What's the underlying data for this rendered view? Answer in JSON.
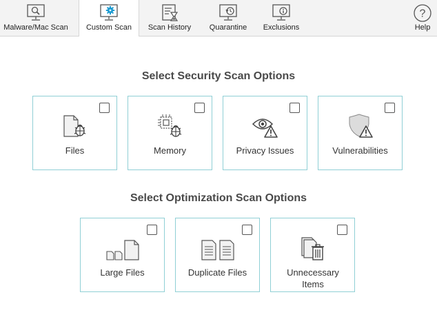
{
  "toolbar": {
    "tabs": [
      {
        "label": "Malware/Mac Scan",
        "icon": "monitor-magnifier-icon"
      },
      {
        "label": "Custom Scan",
        "icon": "monitor-gear-icon"
      },
      {
        "label": "Scan History",
        "icon": "history-hourglass-icon"
      },
      {
        "label": "Quarantine",
        "icon": "monitor-restore-icon"
      },
      {
        "label": "Exclusions",
        "icon": "monitor-info-icon"
      }
    ],
    "help": {
      "label": "Help",
      "icon": "help-icon"
    },
    "active_tab": "Custom Scan"
  },
  "security": {
    "title": "Select Security Scan Options",
    "options": [
      {
        "label": "Files",
        "icon": "file-bug-icon",
        "checked": false
      },
      {
        "label": "Memory",
        "icon": "chip-bug-icon",
        "checked": false
      },
      {
        "label": "Privacy Issues",
        "icon": "eye-warning-icon",
        "checked": false
      },
      {
        "label": "Vulnerabilities",
        "icon": "shield-warning-icon",
        "checked": false
      }
    ]
  },
  "optimization": {
    "title": "Select Optimization Scan Options",
    "options": [
      {
        "label": "Large Files",
        "icon": "large-files-icon",
        "checked": false
      },
      {
        "label": "Duplicate Files",
        "icon": "duplicate-files-icon",
        "checked": false
      },
      {
        "label": "Unnecessary Items",
        "icon": "file-trash-icon",
        "checked": false
      }
    ]
  },
  "colors": {
    "card_border": "#8fcfd5",
    "toolbar_bg": "#f3f3f3",
    "accent_icon": "#1d9bd1"
  }
}
